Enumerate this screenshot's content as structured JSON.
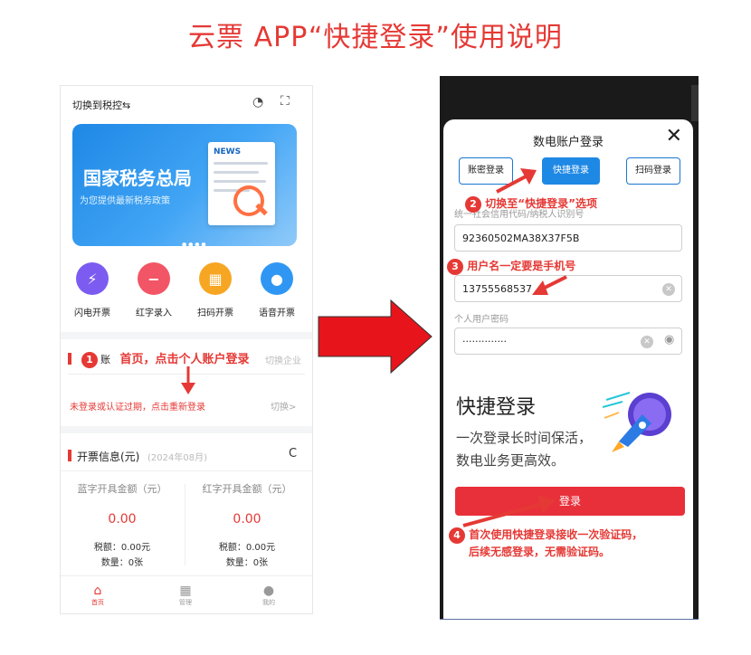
{
  "title": "云票 APP“快捷登录”使用说明",
  "colors": {
    "accent": "#e53935",
    "blue": "#1e88e5"
  },
  "left": {
    "switch_tax": "切换到税控⇆",
    "banner": {
      "title": "国家税务总局",
      "subtitle": "为您提供最新税务政策",
      "news": "NEWS"
    },
    "menu": [
      {
        "label": "闪电开票",
        "icon": "lightning-icon",
        "color": "#7c5cf0",
        "glyph": "⚡"
      },
      {
        "label": "红字录入",
        "icon": "minus-icon",
        "color": "#f25565",
        "glyph": "−"
      },
      {
        "label": "扫码开票",
        "icon": "grid-icon",
        "color": "#f7a623",
        "glyph": "▦"
      },
      {
        "label": "语音开票",
        "icon": "mic-icon",
        "color": "#2f97f3",
        "glyph": "🎤"
      }
    ],
    "account_title": "账",
    "account_right": "切换企业",
    "relogin": "未登录或认证过期，点击重新登录",
    "relogin_right": "切换>",
    "invoice": {
      "title": "开票信息(元)",
      "date": "(2024年08月)"
    },
    "cols": [
      {
        "header": "蓝字开具金额（元）",
        "value": "0.00",
        "tax": "税额：0.00元",
        "count": "数量：0张"
      },
      {
        "header": "红字开具金额（元）",
        "value": "0.00",
        "tax": "税额：0.00元",
        "count": "数量：0张"
      }
    ],
    "tabs": [
      {
        "label": "首页",
        "icon": "home-icon"
      },
      {
        "label": "管理",
        "icon": "apps-icon"
      },
      {
        "label": "我的",
        "icon": "user-icon"
      }
    ]
  },
  "right": {
    "sheet_title": "数电账户登录",
    "tabs": [
      "账密登录",
      "快捷登录",
      "扫码登录"
    ],
    "fields": {
      "credit_code_label": "统一社会信用代码/纳税人识别号",
      "credit_code_value": "92360502MA38X37F5B",
      "username_value": "13755568537",
      "password_label": "个人用户密码",
      "password_value": "··············"
    },
    "promo": {
      "title": "快捷登录",
      "line1": "一次登录长时间保活，",
      "line2": "数电业务更高效。"
    },
    "login_button": "登录"
  },
  "annotations": {
    "step1": {
      "num": "1",
      "text": "首页，点击个人账户登录"
    },
    "step2": {
      "num": "2",
      "text": "切换至“快捷登录”选项"
    },
    "step3": {
      "num": "3",
      "text": "用户名一定要是手机号"
    },
    "step4": {
      "num": "4",
      "line1": "首次使用快捷登录接收一次验证码，",
      "line2": "后续无感登录，无需验证码。"
    }
  }
}
